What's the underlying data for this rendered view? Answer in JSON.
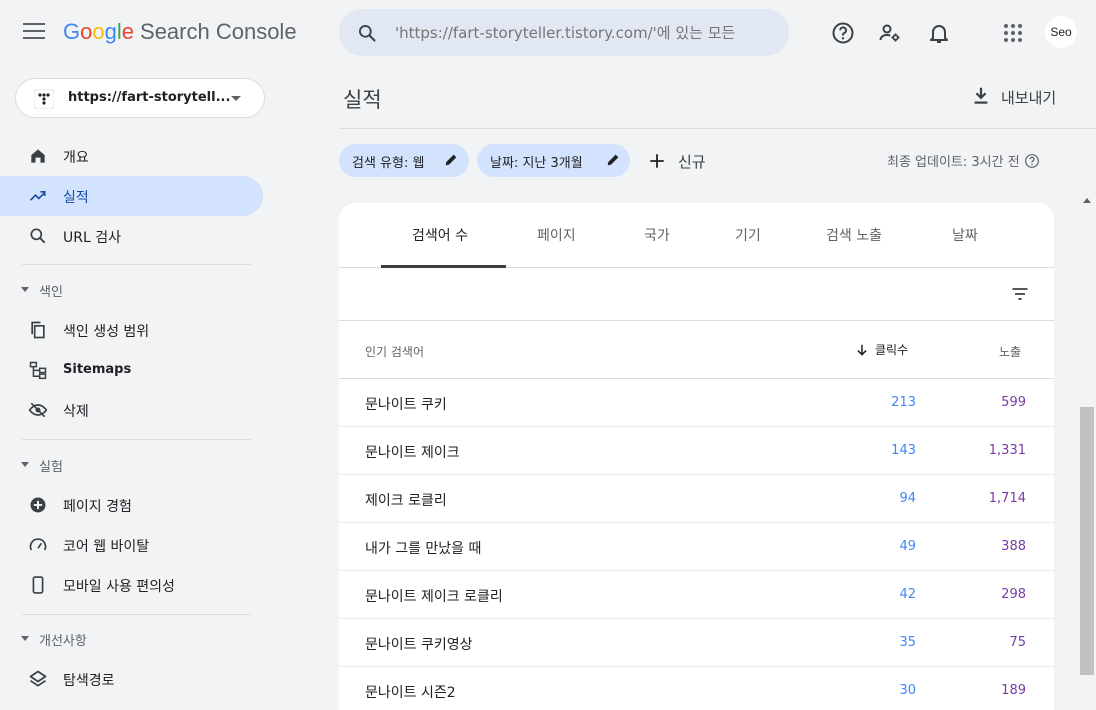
{
  "header": {
    "logo": {
      "g1": "G",
      "o1": "o",
      "o2": "o",
      "g2": "g",
      "l": "l",
      "e": "e",
      "product": "Search Console"
    },
    "search_placeholder": "'https://fart-storyteller.tistory.com/'에 있는 모든",
    "avatar_label": "Seo",
    "icons": [
      "menu-icon",
      "search-icon",
      "help-icon",
      "manage-users-icon",
      "notification-bell-icon",
      "apps-grid-icon"
    ]
  },
  "sidebar": {
    "property": "https://fart-storytell...",
    "nav": {
      "overview": "개요",
      "performance": "실적",
      "url_inspection": "URL 검사"
    },
    "sections": {
      "index": {
        "title": "색인",
        "items": [
          "색인 생성 범위",
          "Sitemaps",
          "삭제"
        ]
      },
      "experience": {
        "title": "실험",
        "items": [
          "페이지 경험",
          "코어 웹 바이탈",
          "모바일 사용 편의성"
        ]
      },
      "enhancements": {
        "title": "개선사항",
        "items": [
          "탐색경로"
        ]
      }
    }
  },
  "main": {
    "title": "실적",
    "export_label": "내보내기",
    "chips": [
      "검색 유형: 웹",
      "날짜: 지난 3개월"
    ],
    "new_label": "신규",
    "updated": "최종 업데이트: 3시간 전",
    "tabs": [
      "검색어 수",
      "페이지",
      "국가",
      "기기",
      "검색 노출",
      "날짜"
    ],
    "active_tab": 0,
    "table": {
      "headers": {
        "query": "인기 검색어",
        "clicks": "클릭수",
        "impressions": "노출"
      },
      "rows": [
        {
          "query": "문나이트 쿠키",
          "clicks": "213",
          "impressions": "599"
        },
        {
          "query": "문나이트 제이크",
          "clicks": "143",
          "impressions": "1,331"
        },
        {
          "query": "제이크 로클리",
          "clicks": "94",
          "impressions": "1,714"
        },
        {
          "query": "내가 그를 만났을 때",
          "clicks": "49",
          "impressions": "388"
        },
        {
          "query": "문나이트 제이크 로클리",
          "clicks": "42",
          "impressions": "298"
        },
        {
          "query": "문나이트 쿠키영상",
          "clicks": "35",
          "impressions": "75"
        },
        {
          "query": "문나이트 시즌2",
          "clicks": "30",
          "impressions": "189"
        }
      ]
    }
  },
  "colors": {
    "accent": "#d3e3fd",
    "clicks": "#4285f4",
    "impressions": "#7b3ba6"
  }
}
